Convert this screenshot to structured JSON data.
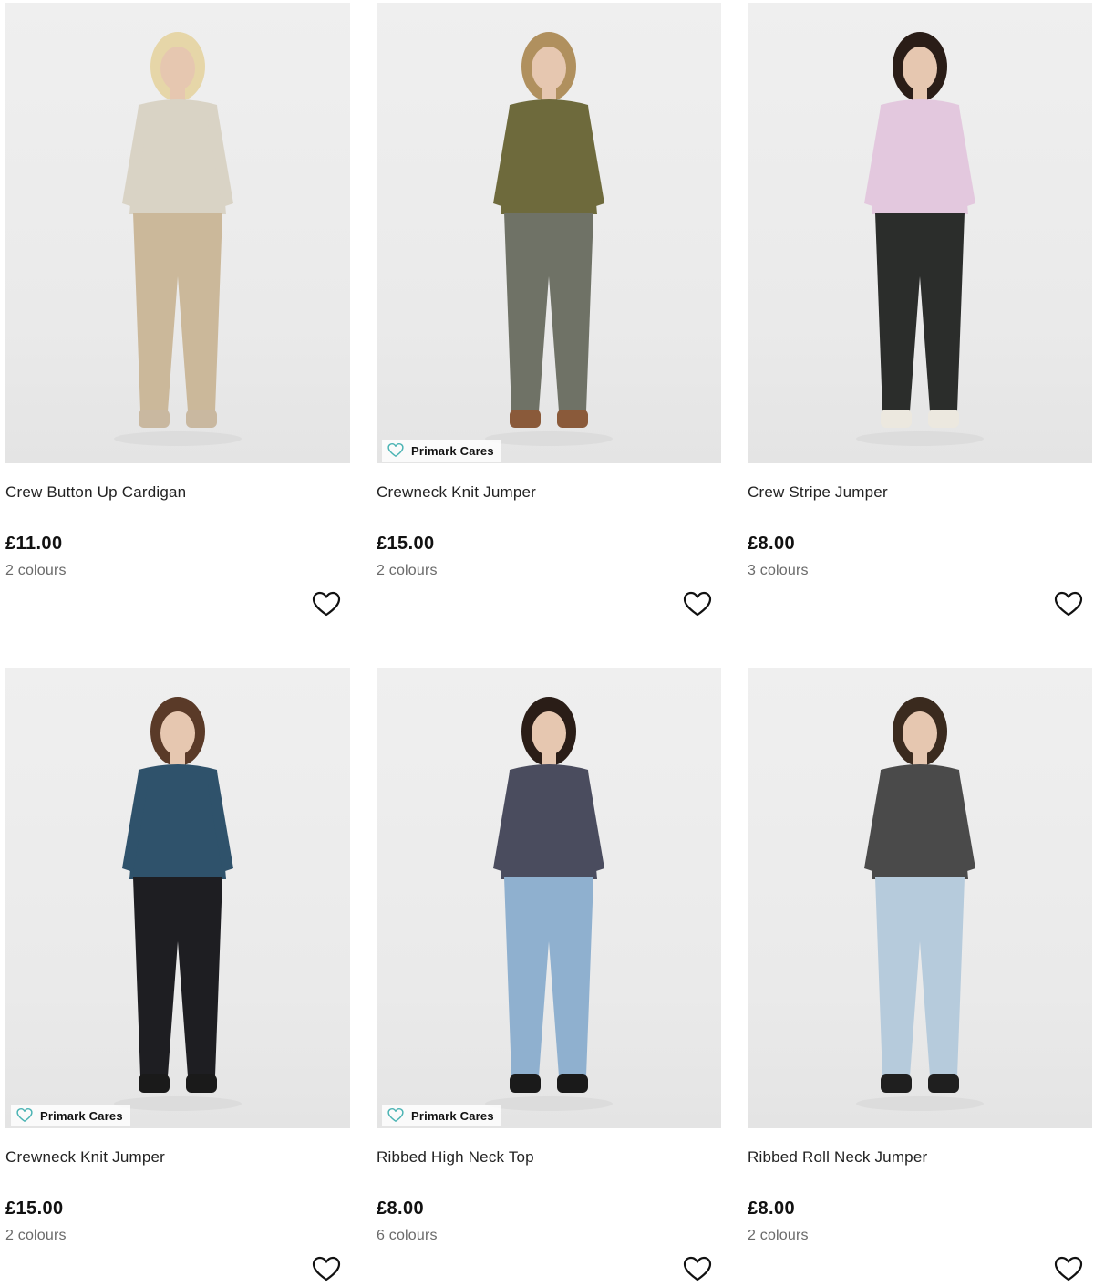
{
  "badge": {
    "label": "Primark Cares",
    "icon": "heart-outline-icon",
    "color": "#4ab3b3"
  },
  "wishlist_icon": "heart-outline-icon",
  "products": [
    {
      "title": "Crew Button Up Cardigan",
      "price": "£11.00",
      "colours": "2 colours",
      "cares": false,
      "palette": {
        "top": "#d9d3c5",
        "bottom": "#cbb89a",
        "hair": "#e6d6a8",
        "shoes": "#c9b8a0"
      }
    },
    {
      "title": "Crewneck Knit Jumper",
      "price": "£15.00",
      "colours": "2 colours",
      "cares": true,
      "palette": {
        "top": "#6e6a3c",
        "bottom": "#6f7266",
        "hair": "#b0905e",
        "shoes": "#8a5a3a"
      }
    },
    {
      "title": "Crew Stripe Jumper",
      "price": "£8.00",
      "colours": "3 colours",
      "cares": false,
      "palette": {
        "top": "#e3c8de",
        "bottom": "#2b2d2b",
        "hair": "#2a1d17",
        "shoes": "#ece8df"
      }
    },
    {
      "title": "Crewneck Knit Jumper",
      "price": "£15.00",
      "colours": "2 colours",
      "cares": true,
      "palette": {
        "top": "#2f526b",
        "bottom": "#1e1e22",
        "hair": "#5a3a28",
        "shoes": "#1a1a1a"
      }
    },
    {
      "title": "Ribbed High Neck Top",
      "price": "£8.00",
      "colours": "6 colours",
      "cares": true,
      "palette": {
        "top": "#4a4c5e",
        "bottom": "#8fb0cf",
        "hair": "#2a1d17",
        "shoes": "#1a1a1a"
      }
    },
    {
      "title": "Ribbed Roll Neck Jumper",
      "price": "£8.00",
      "colours": "2 colours",
      "cares": false,
      "palette": {
        "top": "#4a4a4a",
        "bottom": "#b6cbdc",
        "hair": "#3a2a1e",
        "shoes": "#1f1f1f"
      }
    }
  ]
}
